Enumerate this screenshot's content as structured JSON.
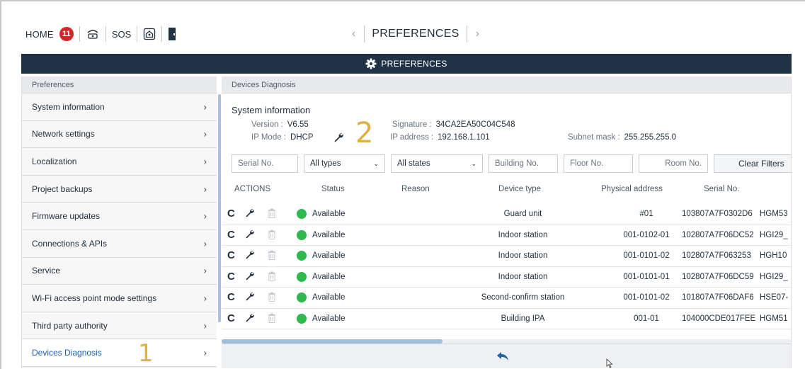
{
  "topbar": {
    "home_label": "HOME",
    "notification_count": "11",
    "sos_label": "SOS",
    "title": "PREFERENCES",
    "prev_icon": "chevron-left-icon",
    "next_icon": "chevron-right-icon"
  },
  "header": {
    "title": "PREFERENCES",
    "icon": "gear-icon"
  },
  "sidebar": {
    "heading": "Preferences",
    "items": [
      {
        "label": "System information"
      },
      {
        "label": "Network settings"
      },
      {
        "label": "Localization"
      },
      {
        "label": "Project backups"
      },
      {
        "label": "Firmware updates"
      },
      {
        "label": "Connections & APIs"
      },
      {
        "label": "Service"
      },
      {
        "label": "Wi-Fi access point mode settings"
      },
      {
        "label": "Third party authority"
      },
      {
        "label": "Devices Diagnosis"
      }
    ],
    "active_index": 9,
    "annotation": "1"
  },
  "main": {
    "heading": "Devices Diagnosis",
    "sysinfo": {
      "title": "System information",
      "version_label": "Version :",
      "version_value": "V6.55",
      "ipmode_label": "IP Mode :",
      "ipmode_value": "DHCP",
      "signature_label": "Signature :",
      "signature_value": "34CA2EA50C04C548",
      "ip_label": "IP address :",
      "ip_value": "192.168.1.101",
      "subnet_label": "Subnet mask :",
      "subnet_value": "255.255.255.0",
      "annotation": "2"
    },
    "filters": {
      "serial_placeholder": "Serial No.",
      "type_value": "All types",
      "state_value": "All states",
      "building_placeholder": "Building No.",
      "floor_placeholder": "Floor No.",
      "room_placeholder": "Room No.",
      "clear_label": "Clear Filters"
    },
    "columns": [
      "ACTIONS",
      "Status",
      "Reason",
      "Device type",
      "Physical address",
      "Serial No."
    ],
    "rows": [
      {
        "status": "Available",
        "reason": "",
        "device_type": "Guard unit",
        "physical_address": "#01",
        "serial": "103807A7F0302D6",
        "extra": "HGM53"
      },
      {
        "status": "Available",
        "reason": "",
        "device_type": "Indoor station",
        "physical_address": "001-0102-01",
        "serial": "102807A7F06DC52",
        "extra": "HGI29_"
      },
      {
        "status": "Available",
        "reason": "",
        "device_type": "Indoor station",
        "physical_address": "001-0101-02",
        "serial": "102807A7F063253",
        "extra": "HGH10"
      },
      {
        "status": "Available",
        "reason": "",
        "device_type": "Indoor station",
        "physical_address": "001-0101-01",
        "serial": "102807A7F06DC59",
        "extra": "HGI29_"
      },
      {
        "status": "Available",
        "reason": "",
        "device_type": "Second-confirm station",
        "physical_address": "001-0101-02",
        "serial": "101807A7F06DAF6",
        "extra": "HSE07-"
      },
      {
        "status": "Available",
        "reason": "",
        "device_type": "Building IPA",
        "physical_address": "001-01",
        "serial": "104000CDE017FEE",
        "extra": "HGM51"
      }
    ],
    "status_color": "#2fb84d"
  },
  "colors": {
    "header_bg": "#1f3246",
    "badge_red": "#d8232a",
    "annotation_gold": "#e0b040",
    "accent_blue": "#2362a5"
  }
}
